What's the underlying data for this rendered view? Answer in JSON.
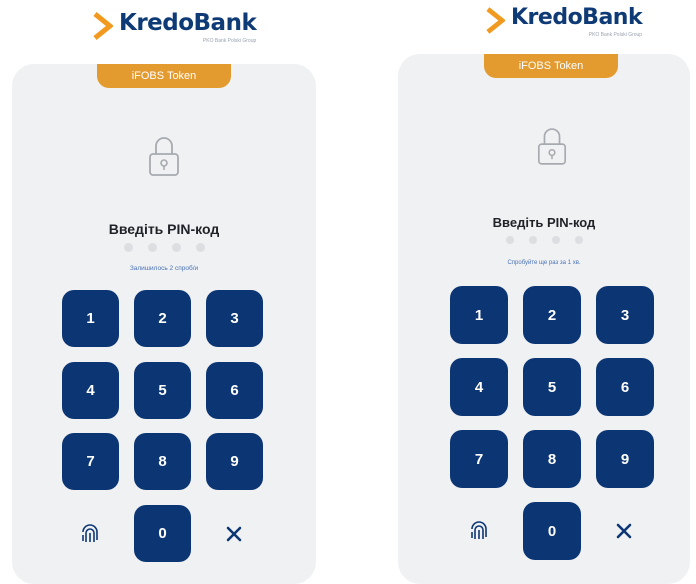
{
  "screens": [
    {
      "logo": {
        "brand": "KredoBank",
        "subtitle": "PKO Bank Polski Group"
      },
      "tab_label": "iFOBS Token",
      "prompt": "Введіть PIN-код",
      "status": "Залишилось 2 спроб/и",
      "keys": [
        "1",
        "2",
        "3",
        "4",
        "5",
        "6",
        "7",
        "8",
        "9",
        "0"
      ],
      "icons": {
        "lock": "lock-icon",
        "fingerprint": "fingerprint-icon",
        "delete": "close-icon"
      }
    },
    {
      "logo": {
        "brand": "KredoBank",
        "subtitle": "PKO Bank Polski Group"
      },
      "tab_label": "iFOBS Token",
      "prompt": "Введіть PIN-код",
      "status": "Спробуйте ще раз за 1 хв.",
      "keys": [
        "1",
        "2",
        "3",
        "4",
        "5",
        "6",
        "7",
        "8",
        "9",
        "0"
      ],
      "icons": {
        "lock": "lock-icon",
        "fingerprint": "fingerprint-icon",
        "delete": "close-icon"
      }
    }
  ],
  "colors": {
    "brand_navy": "#0c3673",
    "accent_orange": "#e39a2f",
    "card_bg": "#f0f1f3",
    "status_blue": "#4a72b8"
  }
}
